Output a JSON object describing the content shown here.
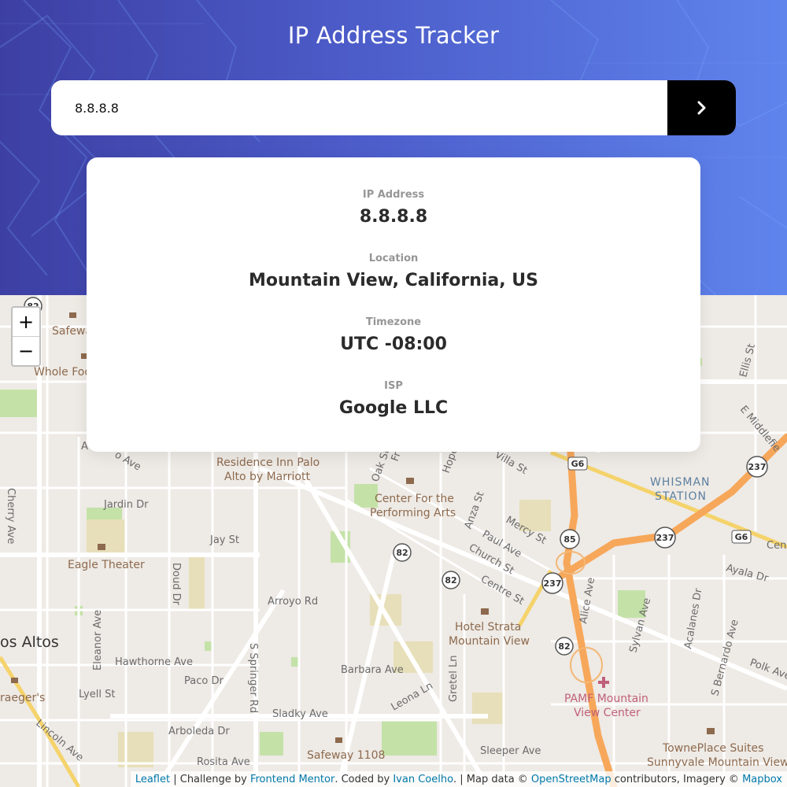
{
  "header": {
    "title": "IP Address Tracker",
    "search_value": "8.8.8.8",
    "submit_icon": "chevron-right-icon"
  },
  "info": {
    "ip_label": "IP Address",
    "ip_value": "8.8.8.8",
    "location_label": "Location",
    "location_value": "Mountain View, California, US",
    "timezone_label": "Timezone",
    "timezone_value": "UTC -08:00",
    "isp_label": "ISP",
    "isp_value": "Google LLC"
  },
  "map": {
    "zoom_in": "+",
    "zoom_out": "−",
    "streets": [
      "Safewa",
      "Whole Foo",
      "Cherry Ave",
      "Jardin Dr",
      "Jay St",
      "Eagle Theater",
      "Doud Dr",
      "Arroyo Rd",
      "os Altos",
      "Eleanor Ave",
      "Hawthorne Ave",
      "Paco Dr",
      "Lyell St",
      "Sladky Ave",
      "Arboleda Dr",
      "Rosita Ave",
      "Lincoln Ave",
      "raeger's",
      "Barbara Ave",
      "Leona Ln",
      "Gretel Ln",
      "S Springer Rd",
      "Oak St",
      "Hope",
      "Villa St",
      "Anza St",
      "Mercy St",
      "Paul Ave",
      "Church St",
      "Centre St",
      "Alice Ave",
      "Sylvan Ave",
      "Acalanes Dr",
      "S Bernardo Ave",
      "Polk Ave",
      "Ayala Dr",
      "Ellis St",
      "E Middlefie",
      "Cen",
      "Sleeper Ave",
      "Safeway 1108",
      "A",
      "o Ave",
      "Fr"
    ],
    "pois": [
      "Residence Inn Palo",
      "Alto by Marriott",
      "Center For the",
      "Performing Arts",
      "Hotel Strata",
      "Mountain View",
      "PAMF Mountain",
      "View Center",
      "TownePlace Suites",
      "Sunnyvale Mountain View"
    ],
    "station": [
      "WHISMAN",
      "STATION"
    ],
    "shields": [
      "82",
      "82",
      "82",
      "82",
      "85",
      "237",
      "237",
      "237",
      "G6",
      "G6"
    ]
  },
  "attribution": {
    "leaflet": "Leaflet",
    "sep1": " | Challenge by ",
    "fm": "Frontend Mentor",
    "coded": ". Coded by ",
    "author": "Ivan Coelho",
    "mapdata": ". | Map data © ",
    "osm": "OpenStreetMap",
    "contrib": " contributors, Imagery © ",
    "mapbox": "Mapbox"
  }
}
